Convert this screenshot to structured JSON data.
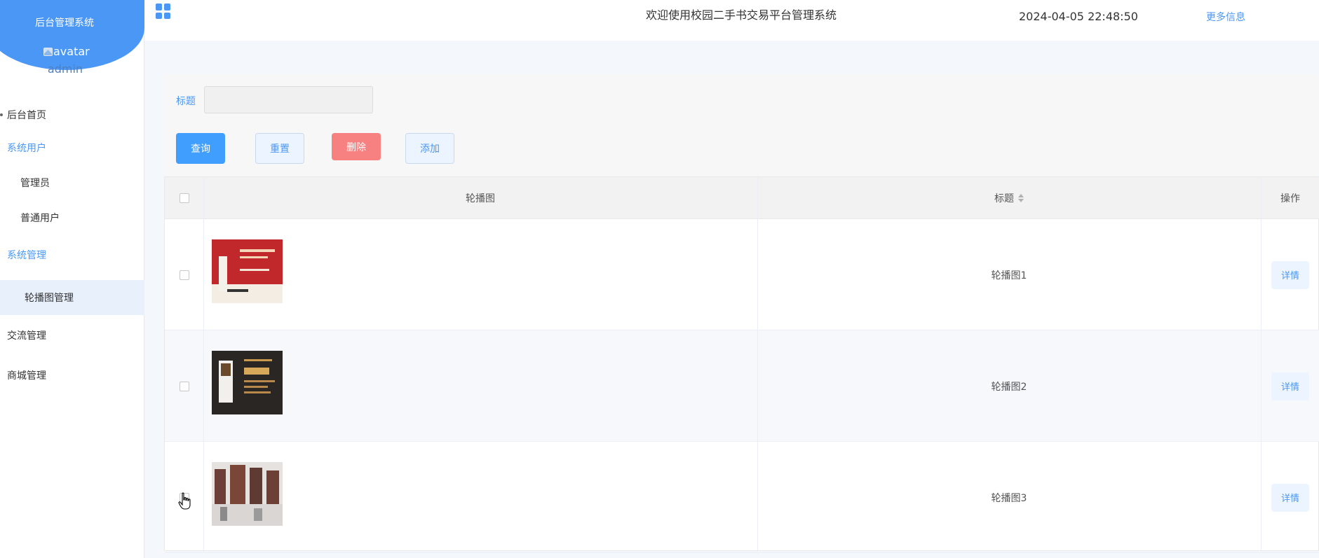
{
  "sidebar": {
    "system_title": "后台管理系统",
    "avatar_alt": "avatar",
    "username": "admin",
    "menu": [
      {
        "label": "后台首页"
      },
      {
        "label": "系统用户"
      },
      {
        "label": "管理员"
      },
      {
        "label": "普通用户"
      },
      {
        "label": "系统管理"
      },
      {
        "label": "轮播图管理"
      },
      {
        "label": "交流管理"
      },
      {
        "label": "商城管理"
      }
    ]
  },
  "header": {
    "welcome": "欢迎使用校园二手书交易平台管理系统",
    "datetime": "2024-04-05 22:48:50",
    "more": "更多信息"
  },
  "search": {
    "title_label": "标题",
    "title_value": ""
  },
  "buttons": {
    "query": "查询",
    "reset": "重置",
    "delete": "删除",
    "add": "添加"
  },
  "table": {
    "columns": {
      "image": "轮播图",
      "title": "标题",
      "actions": "操作"
    },
    "rows": [
      {
        "title": "轮播图1",
        "action": "详情"
      },
      {
        "title": "轮播图2",
        "action": "详情"
      },
      {
        "title": "轮播图3",
        "action": "详情"
      }
    ]
  },
  "colors": {
    "primary": "#409eff",
    "danger": "#f78080",
    "sidebar_header": "#4b97f5"
  }
}
